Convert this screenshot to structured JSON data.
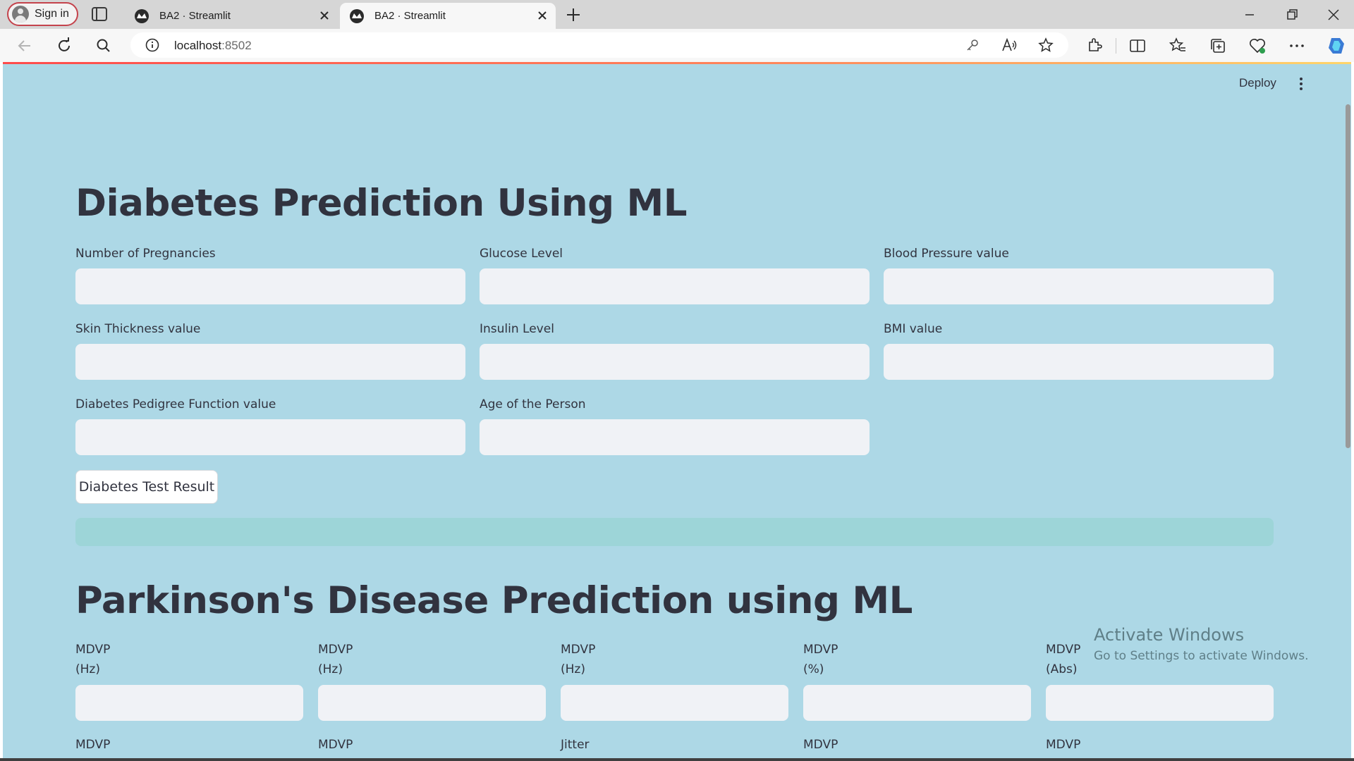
{
  "browser": {
    "sign_in_label": "Sign in",
    "tabs": [
      {
        "title": "BA2 · Streamlit",
        "active": false
      },
      {
        "title": "BA2 · Streamlit",
        "active": true
      }
    ],
    "url_host": "localhost",
    "url_port": ":8502"
  },
  "app": {
    "deploy_label": "Deploy",
    "diabetes": {
      "title": "Diabetes Prediction Using ML",
      "fields": [
        {
          "label": "Number of Pregnancies",
          "value": ""
        },
        {
          "label": "Glucose Level",
          "value": ""
        },
        {
          "label": "Blood Pressure value",
          "value": ""
        },
        {
          "label": "Skin Thickness value",
          "value": ""
        },
        {
          "label": "Insulin Level",
          "value": ""
        },
        {
          "label": "BMI value",
          "value": ""
        },
        {
          "label": "Diabetes Pedigree Function value",
          "value": ""
        },
        {
          "label": "Age of the Person",
          "value": ""
        }
      ],
      "button_label": "Diabetes Test Result",
      "result_text": ""
    },
    "parkinsons": {
      "title": "Parkinson's Disease Prediction using ML",
      "fields_row1": [
        {
          "line1": "MDVP",
          "line2": "(Hz)",
          "value": ""
        },
        {
          "line1": "MDVP",
          "line2": "(Hz)",
          "value": ""
        },
        {
          "line1": "MDVP",
          "line2": "(Hz)",
          "value": ""
        },
        {
          "line1": "MDVP",
          "line2": "(%)",
          "value": ""
        },
        {
          "line1": "MDVP",
          "line2": "(Abs)",
          "value": ""
        }
      ],
      "fields_row2": [
        "MDVP",
        "MDVP",
        "Jitter",
        "MDVP",
        "MDVP"
      ]
    }
  },
  "os": {
    "watermark_line1": "Activate Windows",
    "watermark_line2": "Go to Settings to activate Windows."
  },
  "colors": {
    "page_background": "#add8e6",
    "input_background": "#f0f2f6",
    "result_bar": "#9dd5d8",
    "text": "#31333f"
  }
}
